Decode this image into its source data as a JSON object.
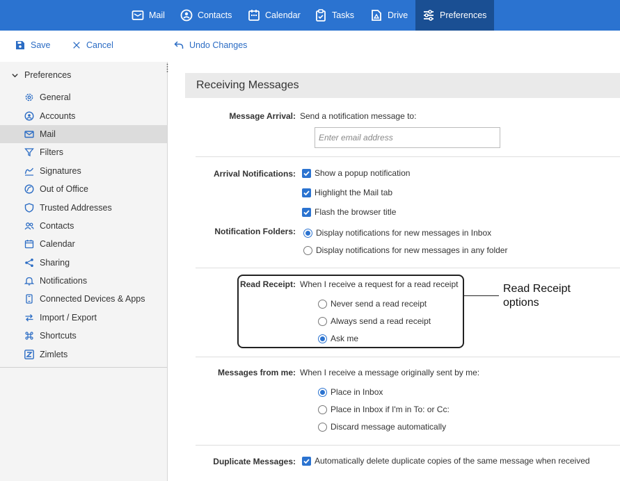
{
  "topnav": {
    "items": [
      {
        "label": "Mail",
        "icon": "mail-icon"
      },
      {
        "label": "Contacts",
        "icon": "contacts-icon"
      },
      {
        "label": "Calendar",
        "icon": "calendar-icon"
      },
      {
        "label": "Tasks",
        "icon": "tasks-icon"
      },
      {
        "label": "Drive",
        "icon": "drive-icon"
      },
      {
        "label": "Preferences",
        "icon": "preferences-icon",
        "active": true
      }
    ]
  },
  "toolbar": {
    "save_label": "Save",
    "cancel_label": "Cancel",
    "undo_label": "Undo Changes"
  },
  "sidebar": {
    "header": "Preferences",
    "items": [
      {
        "label": "General",
        "icon": "gear-icon"
      },
      {
        "label": "Accounts",
        "icon": "account-icon"
      },
      {
        "label": "Mail",
        "icon": "envelope-icon",
        "selected": true
      },
      {
        "label": "Filters",
        "icon": "filter-icon"
      },
      {
        "label": "Signatures",
        "icon": "signature-icon"
      },
      {
        "label": "Out of Office",
        "icon": "out-of-office-icon"
      },
      {
        "label": "Trusted Addresses",
        "icon": "shield-icon"
      },
      {
        "label": "Contacts",
        "icon": "people-icon"
      },
      {
        "label": "Calendar",
        "icon": "calendar-icon"
      },
      {
        "label": "Sharing",
        "icon": "share-icon"
      },
      {
        "label": "Notifications",
        "icon": "bell-icon"
      },
      {
        "label": "Connected Devices & Apps",
        "icon": "device-icon"
      },
      {
        "label": "Import / Export",
        "icon": "import-export-icon"
      },
      {
        "label": "Shortcuts",
        "icon": "command-icon"
      },
      {
        "label": "Zimlets",
        "icon": "zimlet-icon"
      }
    ]
  },
  "main": {
    "section_title": "Receiving Messages",
    "message_arrival": {
      "label": "Message Arrival:",
      "text": "Send a notification message to:",
      "placeholder": "Enter email address"
    },
    "arrival_notifications": {
      "label": "Arrival Notifications:",
      "options": [
        "Show a popup notification",
        "Highlight the Mail tab",
        "Flash the browser title"
      ]
    },
    "notification_folders": {
      "label": "Notification Folders:",
      "options": [
        "Display notifications for new messages in Inbox",
        "Display notifications for new messages in any folder"
      ],
      "selected": 0
    },
    "read_receipt": {
      "label": "Read Receipt:",
      "text": "When I receive a request for a read receipt",
      "options": [
        "Never send a read receipt",
        "Always send a read receipt",
        "Ask me"
      ],
      "selected": 2
    },
    "callout": "Read Receipt options",
    "messages_from_me": {
      "label": "Messages from me:",
      "text": "When I receive a message originally sent by me:",
      "options": [
        "Place in Inbox",
        "Place in Inbox if I'm in To: or Cc:",
        "Discard message automatically"
      ],
      "selected": 0
    },
    "duplicate_messages": {
      "label": "Duplicate Messages:",
      "option": "Automatically delete duplicate copies of the same message when received"
    }
  },
  "colors": {
    "nav_bg": "#2b73d0",
    "nav_active": "#1a4f93",
    "link": "#2b6cc4",
    "sidebar_bg": "#f4f4f4",
    "selected_bg": "#dcdcdc"
  }
}
